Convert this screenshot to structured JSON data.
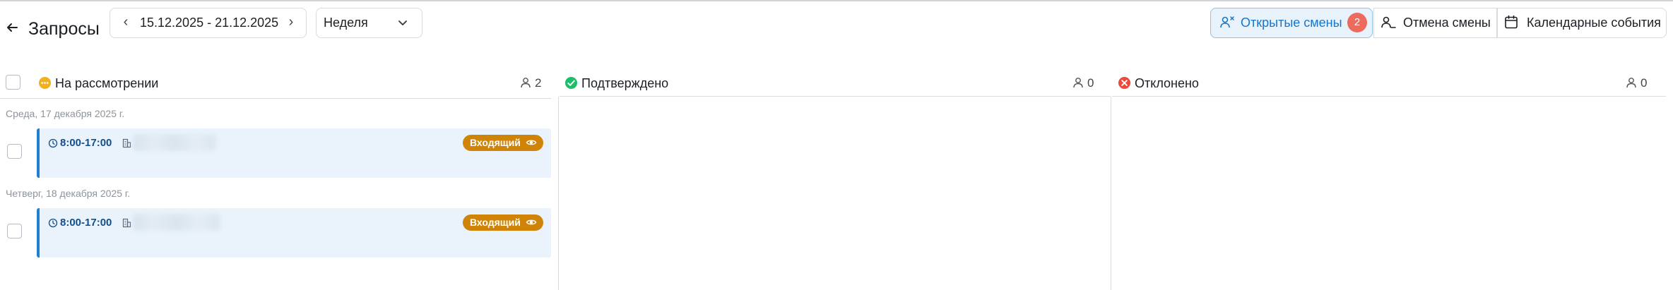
{
  "header": {
    "title": "Запросы",
    "date_range": "15.12.2025 - 21.12.2025",
    "period": "Неделя",
    "buttons": {
      "open_shifts": "Открытые смены",
      "open_shifts_count": "2",
      "cancel_shift": "Отмена смены",
      "calendar_events": "Календарные события"
    }
  },
  "columns": [
    {
      "label": "На рассмотрении",
      "count": "2",
      "status_color": "#f2b01e"
    },
    {
      "label": "Подтверждено",
      "count": "0",
      "status_color": "#1bbf6a"
    },
    {
      "label": "Отклонено",
      "count": "0",
      "status_color": "#ea4b3c"
    }
  ],
  "pending": {
    "groups": [
      {
        "date": "Среда, 17 декабря 2025 г.",
        "card": {
          "time": "8:00-17:00",
          "tag": "Входящий"
        }
      },
      {
        "date": "Четверг, 18 декабря 2025 г.",
        "card": {
          "time": "8:00-17:00",
          "tag": "Входящий"
        }
      }
    ]
  },
  "colors": {
    "accent": "#1976c6",
    "tag": "#cf8407",
    "card_bg": "#eaf3fb",
    "badge": "#ec6a5e"
  }
}
